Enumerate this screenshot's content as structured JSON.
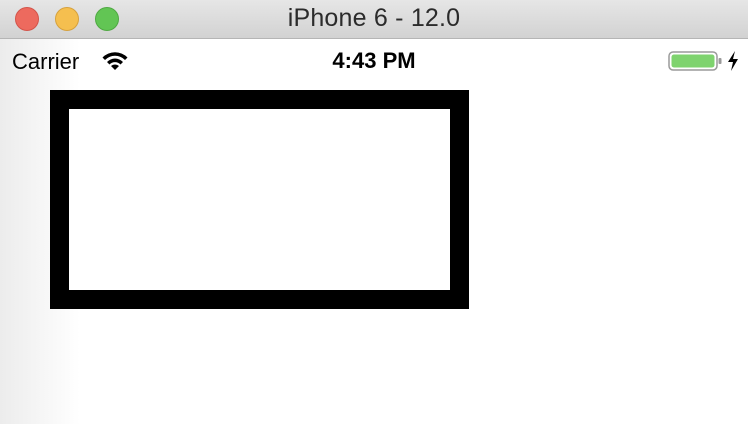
{
  "window": {
    "title": "iPhone 6 - 12.0",
    "controls": [
      "close",
      "minimize",
      "zoom"
    ]
  },
  "status_bar": {
    "carrier": "Carrier",
    "time": "4:43 PM",
    "wifi_icon": "wifi-icon",
    "battery_icon": "battery-icon",
    "charging_icon": "charging-bolt-icon"
  },
  "colors": {
    "close": "#ed6a5e",
    "minimize": "#f5bf4f",
    "zoom": "#62c554",
    "battery_fill": "#7ed36e",
    "border": "#000000"
  }
}
